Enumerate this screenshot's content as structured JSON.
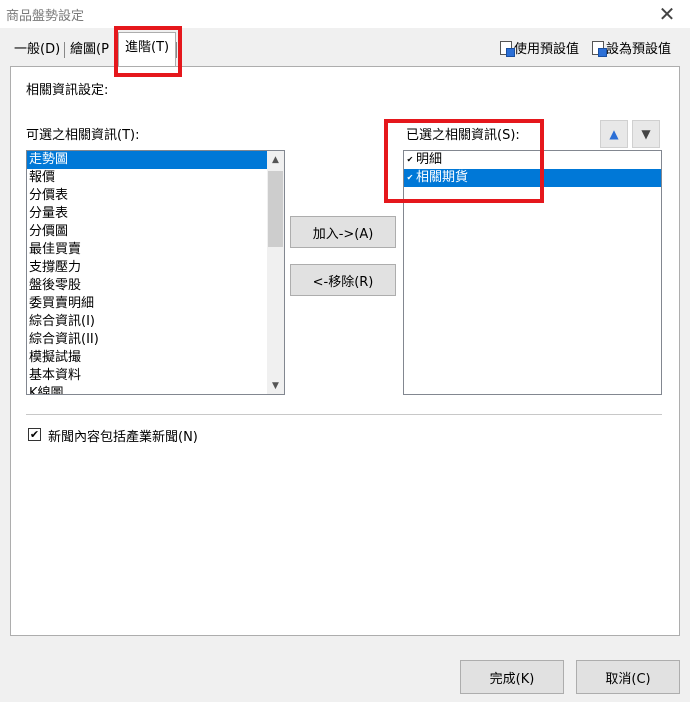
{
  "window": {
    "title": "商品盤勢設定",
    "close_symbol": "✕"
  },
  "tabs": [
    {
      "label": "一般(D)"
    },
    {
      "label": "繪圖(P"
    },
    {
      "label": "進階(T)"
    }
  ],
  "top_actions": {
    "use_default": "使用預設值",
    "set_default": "設為預設值"
  },
  "section_title": "相關資訊設定:",
  "available": {
    "label": "可選之相關資訊(T):",
    "items": [
      "走勢圖",
      "報價",
      "分價表",
      "分量表",
      "分價圖",
      "最佳買賣",
      "支撐壓力",
      "盤後零股",
      "委買賣明細",
      "綜合資訊(I)",
      "綜合資訊(II)",
      "模擬試撮",
      "基本資料",
      "K線圖"
    ],
    "selected_index": 0
  },
  "selected": {
    "label": "已選之相關資訊(S):",
    "items": [
      {
        "label": "明細",
        "checked": true,
        "highlighted": false
      },
      {
        "label": "相關期貨",
        "checked": true,
        "highlighted": true
      }
    ]
  },
  "buttons": {
    "add": "加入->(A)",
    "remove": "<-移除(R)",
    "ok": "完成(K)",
    "cancel": "取消(C)"
  },
  "order_buttons": {
    "up_icon": "▲",
    "down_icon": "▼"
  },
  "news_option": {
    "label": "新聞內容包括產業新聞(N)",
    "checked": true,
    "check_symbol": "✔"
  },
  "colors": {
    "selection": "#0078d7",
    "highlight_box": "#e5171c"
  }
}
